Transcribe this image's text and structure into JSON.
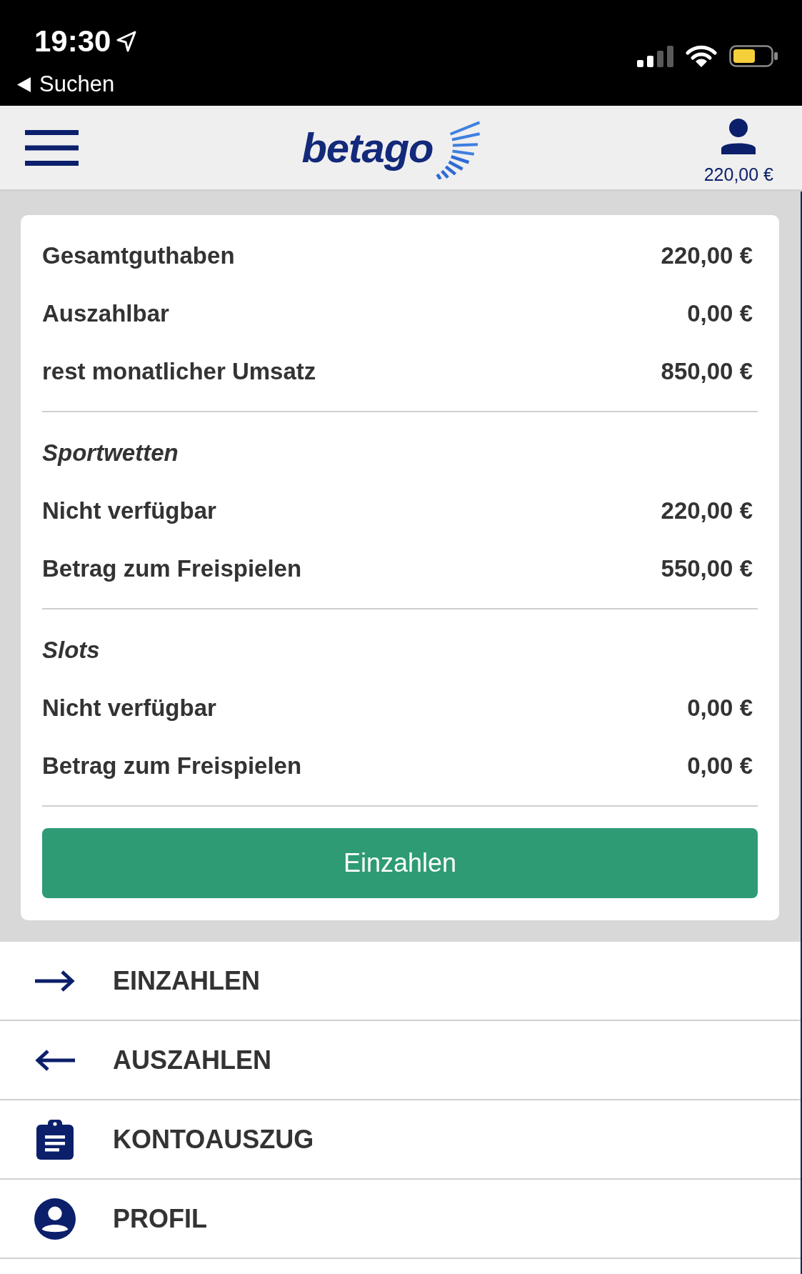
{
  "status_bar": {
    "time": "19:30",
    "back_label": "Suchen"
  },
  "header": {
    "logo": "betago",
    "balance": "220,00 €"
  },
  "balance_card": {
    "groups": [
      {
        "rows": [
          {
            "label": "Gesamtguthaben",
            "value": "220,00 €"
          },
          {
            "label": "Auszahlbar",
            "value": "0,00 €"
          },
          {
            "label": "rest monatlicher Umsatz",
            "value": "850,00 €"
          }
        ]
      },
      {
        "title": "Sportwetten",
        "rows": [
          {
            "label": "Nicht verfügbar",
            "value": "220,00 €"
          },
          {
            "label": "Betrag zum Freispielen",
            "value": "550,00 €"
          }
        ]
      },
      {
        "title": "Slots",
        "rows": [
          {
            "label": "Nicht verfügbar",
            "value": "0,00 €"
          },
          {
            "label": "Betrag zum Freispielen",
            "value": "0,00 €"
          }
        ]
      }
    ],
    "button": "Einzahlen"
  },
  "menu": [
    {
      "kind": "deposit",
      "label": "EINZAHLEN"
    },
    {
      "kind": "withdraw",
      "label": "AUSZAHLEN"
    },
    {
      "kind": "statement",
      "label": "KONTOAUSZUG"
    },
    {
      "kind": "profile",
      "label": "PROFIL"
    }
  ]
}
